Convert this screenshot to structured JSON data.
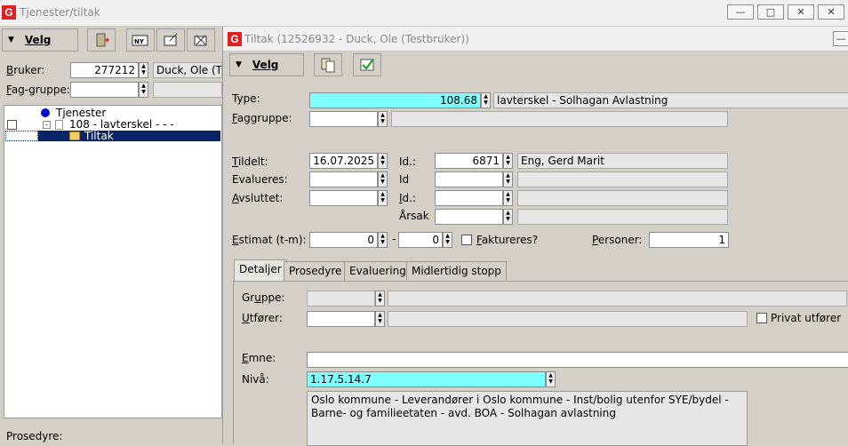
{
  "back_window": {
    "title": "Tjenester/tiltak",
    "toolbar": {
      "velg_label": "Velg"
    },
    "bruker": {
      "label": "Bruker:",
      "id": "277212",
      "name": "Duck, Ole (T"
    },
    "fag_gruppe": {
      "label": "Fag-gruppe:",
      "value": ""
    },
    "tree": {
      "root": "Tjenester",
      "child": "108 - lavterskel -  -  -",
      "leaf": "Tiltak"
    },
    "prosedyre_label": "Prosedyre:"
  },
  "front_window": {
    "title": "Tiltak (12526932 - Duck, Ole (Testbruker))",
    "toolbar": {
      "velg_label": "Velg"
    },
    "type": {
      "label": "Type:",
      "code": "108.68",
      "desc": "lavterskel - Solhagan Avlastning"
    },
    "faggruppe": {
      "label": "Faggruppe:",
      "value": "",
      "desc": ""
    },
    "tildelt": {
      "label": "Tildelt:",
      "date": "16.07.2025",
      "id_label": "Id.:",
      "id": "6871",
      "name": "Eng, Gerd Marit"
    },
    "evalueres": {
      "label": "Evalueres:",
      "date": "",
      "id_label": "Id",
      "id": "",
      "name": ""
    },
    "avsluttet": {
      "label": "Avsluttet:",
      "date": "",
      "id_label": "Id.:",
      "id": "",
      "name": ""
    },
    "arsak": {
      "label": "Årsak",
      "value": "",
      "desc": ""
    },
    "estimat": {
      "label": "Estimat (t-m):",
      "from": "0",
      "dash": "-",
      "to": "0"
    },
    "faktureres": {
      "label": "Faktureres?",
      "checked": false
    },
    "personer": {
      "label": "Personer:",
      "value": "1"
    },
    "tabs": [
      "Detaljer",
      "Prosedyre",
      "Evaluering",
      "Midlertidig stopp"
    ],
    "detaljer": {
      "gruppe_label": "Gruppe:",
      "utforer_label": "Utfører:",
      "privat_utforer_label": "Privat utfører",
      "emne_label": "Emne:",
      "emne_value": "",
      "niva_label": "Nivå:",
      "niva_value": "1.17.5.14.7",
      "niva_desc": "Oslo kommune - Leverandører i Oslo kommune - Inst/bolig utenfor SYE/bydel -\nBarne- og familieetaten - avd. BOA - Solhagan avlastning"
    }
  },
  "colors": {
    "highlight": "#80ffff",
    "selection": "#0a246a",
    "app_icon": "#e02020"
  }
}
